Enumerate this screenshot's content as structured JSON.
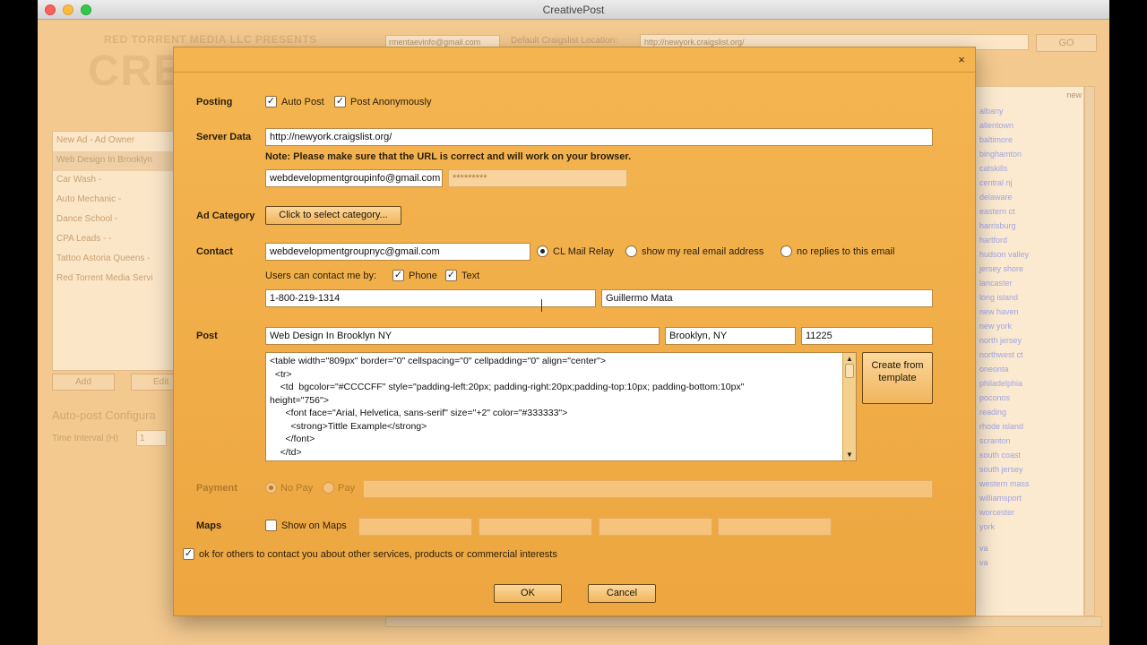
{
  "window": {
    "title": "CreativePost"
  },
  "background": {
    "brand_sub": "RED TORRENT MEDIA LLC PRESENTS",
    "brand": "CREA",
    "email": "rmentaevinfo@gmail.com",
    "default_location_label": "Default Craigslist Location:",
    "default_location": "http://newyork.craigslist.org/",
    "go": "GO",
    "ads": [
      {
        "label": "New Ad - Ad Owner"
      },
      {
        "label": "Web Design In Brooklyn"
      },
      {
        "label": "Car Wash -"
      },
      {
        "label": "Auto Mechanic -"
      },
      {
        "label": "Dance School -"
      },
      {
        "label": "CPA Leads - -"
      },
      {
        "label": "Tattoo Astoria Queens -"
      },
      {
        "label": "Red Torrent Media Servi"
      }
    ],
    "add": "Add",
    "edit": "Edit",
    "auto_post_config": "Auto-post Configura",
    "time_interval_label": "Time Interval (H)",
    "time_interval_value": "1",
    "right_header": "new",
    "cities": [
      "albany",
      "allentown",
      "baltimore",
      "binghamton",
      "catskills",
      "central nj",
      "delaware",
      "eastern ct",
      "harrisburg",
      "hartford",
      "hudson valley",
      "jersey shore",
      "lancaster",
      "long island",
      "new haven",
      "new york",
      "north jersey",
      "northwest ct",
      "oneonta",
      "philadelphia",
      "poconos",
      "reading",
      "rhode island",
      "scranton",
      "south coast",
      "south jersey",
      "western mass",
      "williamsport",
      "worcester",
      "york"
    ],
    "right_footer": [
      "va",
      "va"
    ]
  },
  "dialog": {
    "posting_label": "Posting",
    "auto_post": "Auto Post",
    "post_anon": "Post Anonymously",
    "server_label": "Server Data",
    "server_url": "http://newyork.craigslist.org/",
    "note": "Note: Please make sure that the URL is correct and will work on your browser.",
    "account_email": "webdevelopmentgroupinfo@gmail.com",
    "account_password": "*********",
    "ad_category_label": "Ad Category",
    "category_button": "Click to select category...",
    "contact_label": "Contact",
    "contact_email": "webdevelopmentgroupnyc@gmail.com",
    "cl_mail_relay": "CL Mail Relay",
    "show_real_email": "show my real email address",
    "no_replies": "no replies to this email",
    "users_contact_by": "Users can contact me by:",
    "phone_label": "Phone",
    "text_label": "Text",
    "phone_number": "1-800-219-1314",
    "contact_name": "Guillermo Mata",
    "post_label": "Post",
    "post_title": "Web Design In Brooklyn NY",
    "post_location": "Brooklyn, NY",
    "post_zip": "11225",
    "html_lines": [
      "<table width=\"809px\" border=\"0\" cellspacing=\"0\" cellpadding=\"0\" align=\"center\">",
      "  <tr>",
      "    <td  bgcolor=\"#CCCCFF\" style=\"padding-left:20px; padding-right:20px;padding-top:10px; padding-bottom:10px\"",
      "height=\"756\">",
      "      <font face=\"Arial, Helvetica, sans-serif\" size=\"+2\" color=\"#333333\">",
      "        <strong>Tittle Example</strong>",
      "      </font>",
      "    </td>"
    ],
    "create_template": "Create from template",
    "payment_label": "Payment",
    "no_pay": "No Pay",
    "pay": "Pay",
    "maps_label": "Maps",
    "show_on_maps": "Show on Maps",
    "ok_contact": "ok for others to contact you about other services, products or commercial interests",
    "ok": "OK",
    "cancel": "Cancel",
    "close": "×"
  }
}
